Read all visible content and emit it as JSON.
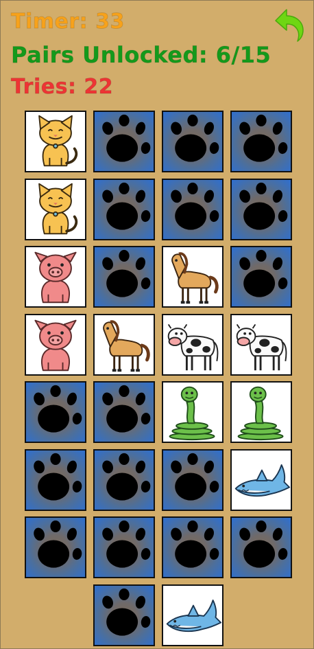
{
  "hud": {
    "timer_label": "Timer",
    "timer_value": "33",
    "pairs_label": "Pairs Unlocked",
    "pairs_value": "6/15",
    "tries_label": "Tries",
    "tries_value": "22",
    "timer_color": "#f7a21b",
    "pairs_color": "#149a1b",
    "tries_color": "#ee3434"
  },
  "undo_icon": "undo-arrow-icon",
  "undo_color": "#6fd613",
  "board": {
    "rows": [
      [
        "cat",
        "back",
        "back",
        "back"
      ],
      [
        "cat",
        "back",
        "back",
        "back"
      ],
      [
        "pig",
        "back",
        "horse",
        "back"
      ],
      [
        "pig",
        "horse",
        "cow",
        "cow"
      ],
      [
        "back",
        "back",
        "snake",
        "snake"
      ],
      [
        "back",
        "back",
        "back",
        "shark"
      ],
      [
        "back",
        "back",
        "back",
        "back"
      ],
      [
        "",
        "back",
        "shark",
        ""
      ]
    ],
    "card_back_icon": "paw-print-icon"
  }
}
